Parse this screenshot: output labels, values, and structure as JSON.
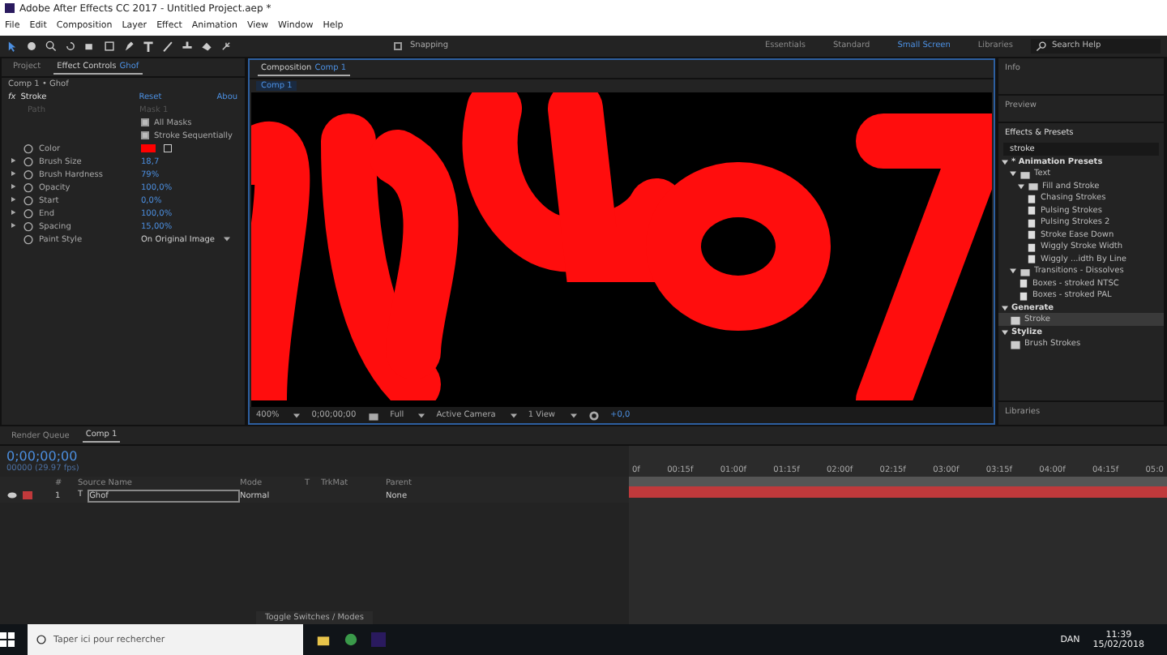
{
  "window": {
    "title": "Adobe After Effects CC 2017 - Untitled Project.aep *"
  },
  "menu": [
    "File",
    "Edit",
    "Composition",
    "Layer",
    "Effect",
    "Animation",
    "View",
    "Window",
    "Help"
  ],
  "toolbar": {
    "snapping": {
      "label": "Snapping",
      "checked": false
    },
    "workspaces": [
      {
        "label": "Essentials",
        "selected": false
      },
      {
        "label": "Standard",
        "selected": false
      },
      {
        "label": "Small Screen",
        "selected": true
      },
      {
        "label": "Libraries",
        "selected": false
      }
    ],
    "search": {
      "placeholder": "Search Help"
    }
  },
  "effect_controls": {
    "tabs": [
      {
        "label": "Project",
        "selected": false
      },
      {
        "label": "Effect Controls",
        "target": "Ghof",
        "selected": true
      }
    ],
    "breadcrumb": "Comp 1 • Ghof",
    "effect": {
      "badge": "fx",
      "name": "Stroke",
      "reset": "Reset",
      "about": "Abou",
      "path_label": "Path",
      "path_value": "Mask 1"
    },
    "options": [
      {
        "label": "All Masks",
        "checked": true
      },
      {
        "label": "Stroke Sequentially",
        "checked": true
      }
    ],
    "properties": [
      {
        "name": "Color",
        "kind": "color",
        "color": "#ff0000",
        "expandable": false
      },
      {
        "name": "Brush Size",
        "kind": "value",
        "value": "18,7",
        "expandable": true
      },
      {
        "name": "Brush Hardness",
        "kind": "value",
        "value": "79%",
        "expandable": true
      },
      {
        "name": "Opacity",
        "kind": "value",
        "value": "100,0%",
        "expandable": true
      },
      {
        "name": "Start",
        "kind": "value",
        "value": "0,0%",
        "expandable": true
      },
      {
        "name": "End",
        "kind": "value",
        "value": "100,0%",
        "expandable": true
      },
      {
        "name": "Spacing",
        "kind": "value",
        "value": "15,00%",
        "expandable": true
      },
      {
        "name": "Paint Style",
        "kind": "dropdown",
        "value": "On Original Image",
        "expandable": false
      }
    ]
  },
  "composition": {
    "tab": {
      "label": "Composition",
      "target": "Comp 1"
    },
    "subtab": "Comp 1",
    "viewer_bar": {
      "zoom": "400%",
      "timecode": "0;00;00;00",
      "resolution": "Full",
      "camera": "Active Camera",
      "views": "1 View",
      "exposure": "+0,0"
    }
  },
  "right_panels": {
    "info": "Info",
    "preview": "Preview",
    "effects_title": "Effects & Presets",
    "search": {
      "value": "stroke"
    },
    "tree": [
      {
        "label": "* Animation Presets",
        "kind": "group",
        "expanded": true,
        "selected": false,
        "children": [
          {
            "label": "Text",
            "kind": "folder",
            "expanded": true,
            "selected": false,
            "children": [
              {
                "label": "Fill and Stroke",
                "kind": "folder",
                "expanded": true,
                "selected": false,
                "children": [
                  {
                    "label": "Chasing Strokes",
                    "kind": "preset",
                    "selected": false
                  },
                  {
                    "label": "Pulsing Strokes",
                    "kind": "preset",
                    "selected": false
                  },
                  {
                    "label": "Pulsing Strokes 2",
                    "kind": "preset",
                    "selected": false
                  },
                  {
                    "label": "Stroke Ease Down",
                    "kind": "preset",
                    "selected": false
                  },
                  {
                    "label": "Wiggly Stroke Width",
                    "kind": "preset",
                    "selected": false
                  },
                  {
                    "label": "Wiggly ...idth By Line",
                    "kind": "preset",
                    "selected": false
                  }
                ]
              }
            ]
          },
          {
            "label": "Transitions - Dissolves",
            "kind": "folder",
            "expanded": true,
            "selected": false,
            "children": [
              {
                "label": "Boxes - stroked NTSC",
                "kind": "preset",
                "selected": false
              },
              {
                "label": "Boxes - stroked PAL",
                "kind": "preset",
                "selected": false
              }
            ]
          }
        ]
      },
      {
        "label": "Generate",
        "kind": "group",
        "expanded": true,
        "selected": false,
        "children": [
          {
            "label": "Stroke",
            "kind": "effect",
            "selected": true
          }
        ]
      },
      {
        "label": "Stylize",
        "kind": "group",
        "expanded": true,
        "selected": false,
        "children": [
          {
            "label": "Brush Strokes",
            "kind": "effect",
            "selected": false
          }
        ]
      }
    ],
    "libraries": "Libraries"
  },
  "timeline": {
    "tabs": [
      {
        "label": "Render Queue",
        "selected": false
      },
      {
        "label": "Comp 1",
        "selected": true
      }
    ],
    "timecode": "0;00;00;00",
    "frame_info": "00000 (29.97 fps)",
    "columns": [
      "#",
      "Source Name",
      "Mode",
      "T",
      "TrkMat",
      "Parent"
    ],
    "layers": [
      {
        "number": "1",
        "type": "T",
        "name": "Ghof",
        "mode": "Normal",
        "parent": "None",
        "color": "#c0393b",
        "visible": true
      }
    ],
    "ruler": [
      "0f",
      "00:15f",
      "01:00f",
      "01:15f",
      "02:00f",
      "02:15f",
      "03:00f",
      "03:15f",
      "04:00f",
      "04:15f",
      "05:0"
    ],
    "toggle": "Toggle Switches / Modes"
  },
  "taskbar": {
    "search": {
      "placeholder": "Taper ici pour rechercher"
    },
    "language": "DAN",
    "time": "11:39",
    "date": "15/02/2018"
  }
}
